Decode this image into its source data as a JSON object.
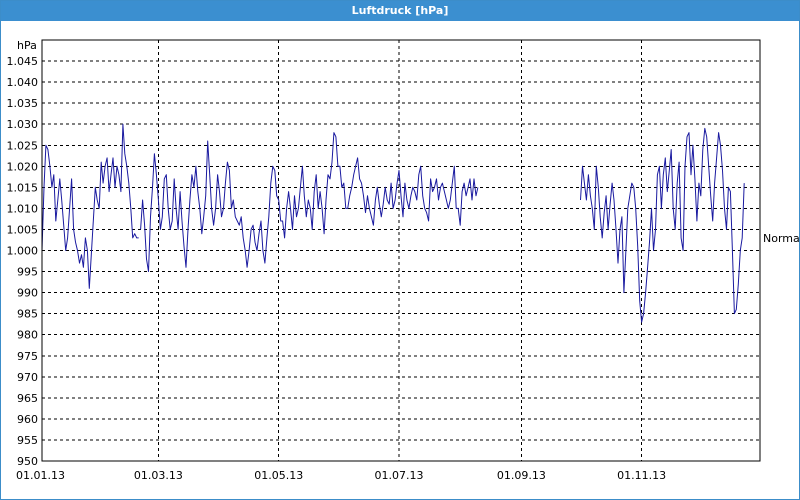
{
  "window": {
    "title": "Luftdruck [hPa]"
  },
  "colors": {
    "titlebar": "#3b8fd0",
    "series": "#1a1aa0",
    "grid": "#000000"
  },
  "chart_data": {
    "type": "line",
    "title": "Luftdruck [hPa]",
    "ylabel": "hPa",
    "xlabel": "",
    "ylim": [
      950,
      1050
    ],
    "xlim": [
      "2013-01-01",
      "2013-12-31"
    ],
    "grid": true,
    "yticks": [
      "950",
      "955",
      "960",
      "965",
      "970",
      "975",
      "980",
      "985",
      "990",
      "995",
      "1.000",
      "1.005",
      "1.010",
      "1.015",
      "1.020",
      "1.025",
      "1.030",
      "1.035",
      "1.040",
      "1.045"
    ],
    "ytick_values": [
      950,
      955,
      960,
      965,
      970,
      975,
      980,
      985,
      990,
      995,
      1000,
      1005,
      1010,
      1015,
      1020,
      1025,
      1030,
      1035,
      1040,
      1045
    ],
    "xticks": [
      "01.01.13",
      "01.03.13",
      "01.05.13",
      "01.07.13",
      "01.09.13",
      "01.11.13"
    ],
    "xtick_dates": [
      "2013-01-01",
      "2013-03-01",
      "2013-05-01",
      "2013-07-01",
      "2013-09-01",
      "2013-11-01"
    ],
    "reference_line": {
      "label": "Normal",
      "value": 1003
    },
    "series": [
      {
        "segments": [
          {
            "start": "2013-01-01",
            "values": [
              1000,
              1015,
              1025,
              1024,
              1020,
              1015,
              1018,
              1007,
              1012,
              1017,
              1012,
              1006,
              1000,
              1003,
              1010,
              1017,
              1005,
              1002,
              1000,
              997,
              999,
              996,
              1003,
              1000,
              991,
              999,
              1007,
              1015,
              1012,
              1010,
              1021,
              1016,
              1020,
              1022,
              1014,
              1018,
              1022,
              1015,
              1020,
              1018,
              1014,
              1030,
              1023,
              1020,
              1016,
              1010,
              1003,
              1004,
              1003,
              1003
            ]
          },
          {
            "start": "2013-02-20",
            "values": [
              1005,
              1012,
              1006,
              998,
              995,
              1008,
              1015,
              1023,
              1018,
              1012,
              1005,
              1008,
              1017,
              1018,
              1010,
              1005,
              1007,
              1017,
              1010,
              1005,
              1014,
              1007,
              1001,
              996,
              1005,
              1012,
              1018,
              1015,
              1020,
              1014,
              1010,
              1004,
              1008,
              1013,
              1026,
              1018,
              1010,
              1006,
              1010,
              1018,
              1014,
              1008,
              1010,
              1016,
              1021,
              1019,
              1010,
              1012,
              1008,
              1007,
              1006,
              1008,
              1003,
              1000,
              996,
              1000,
              1005,
              1006,
              1002,
              1000,
              1004,
              1007,
              1000,
              997,
              1003,
              1008,
              1016,
              1020,
              1019,
              1013,
              1012,
              1007,
              1007,
              1003,
              1010,
              1014,
              1010,
              1005,
              1013,
              1008,
              1010,
              1015,
              1020,
              1013,
              1008,
              1012,
              1010,
              1005,
              1014,
              1018,
              1010,
              1014,
              1010,
              1004,
              1012,
              1018,
              1017,
              1021,
              1028,
              1027,
              1020,
              1020,
              1015,
              1016,
              1010,
              1010,
              1013,
              1015,
              1018,
              1020,
              1022,
              1017,
              1016,
              1013,
              1009,
              1013,
              1010,
              1008,
              1006,
              1012,
              1015,
              1011,
              1008,
              1011,
              1015,
              1012,
              1011,
              1016,
              1010,
              1012,
              1016,
              1019,
              1013,
              1008,
              1016,
              1012,
              1010,
              1013,
              1015,
              1014,
              1012,
              1018,
              1020,
              1013,
              1010,
              1009,
              1007,
              1017,
              1014,
              1015,
              1017,
              1012,
              1015,
              1016,
              1014,
              1012,
              1010,
              1012,
              1016,
              1020,
              1010,
              1010,
              1006,
              1014,
              1016,
              1013,
              1015,
              1017,
              1012,
              1017,
              1013,
              1015
            ]
          },
          {
            "start": "2013-10-01",
            "values": [
              1012,
              1020,
              1016,
              1012,
              1018,
              1013,
              1010,
              1005,
              1020,
              1015,
              1008,
              1003,
              1009,
              1013,
              1005,
              1011,
              1016,
              1012,
              1005,
              997,
              1005,
              1008,
              990,
              1000,
              1010,
              1013,
              1016,
              1015,
              1010,
              1001,
              988,
              983,
              985,
              990,
              996,
              1002,
              1010,
              1000,
              1005,
              1018,
              1020,
              1010,
              1018,
              1022,
              1014,
              1019,
              1024,
              1010,
              1005,
              1016,
              1021,
              1003,
              1000,
              1020,
              1027,
              1028,
              1018,
              1025,
              1017,
              1007,
              1016,
              1013,
              1024,
              1029,
              1027,
              1020,
              1013,
              1007,
              1016,
              1022,
              1028,
              1025,
              1019,
              1010,
              1005,
              1015,
              1014,
              1000,
              985,
              986,
              992,
              1000,
              1003,
              1016
            ]
          }
        ]
      }
    ]
  }
}
